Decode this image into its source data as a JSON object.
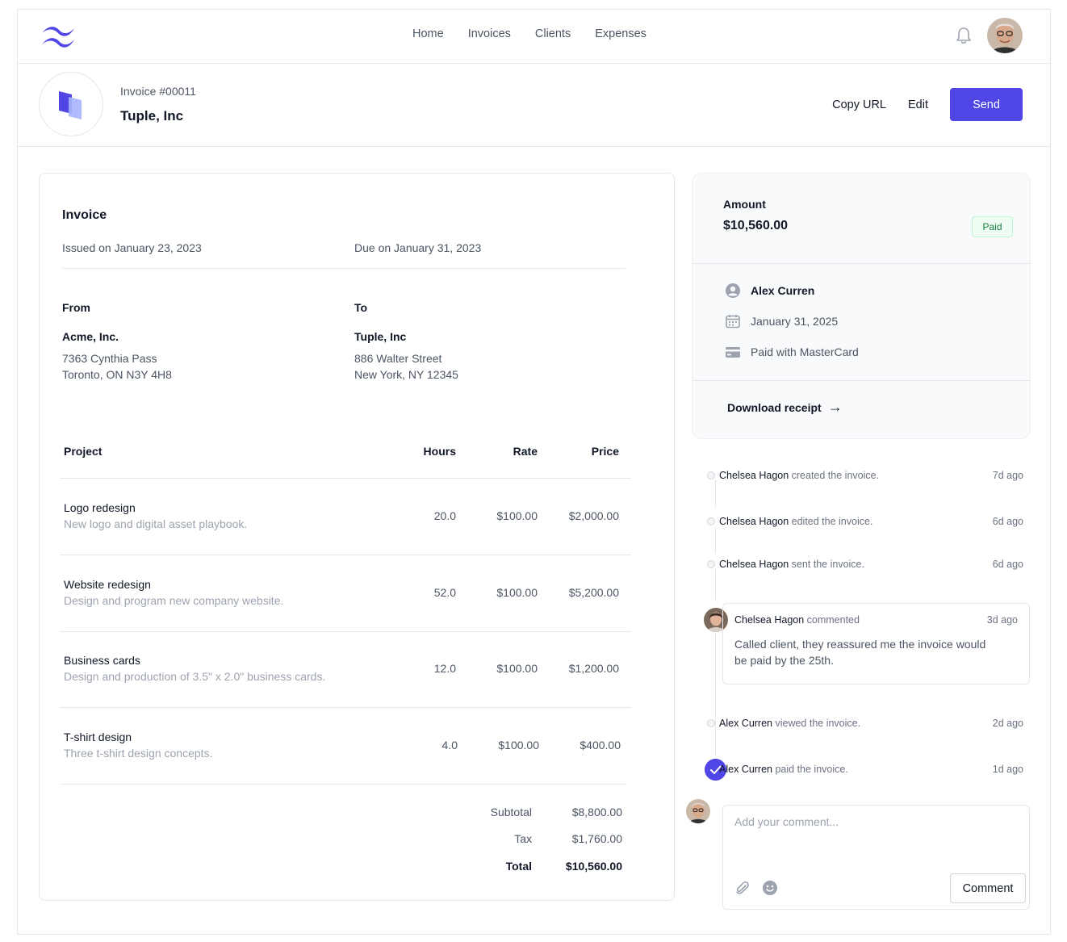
{
  "nav": {
    "links": [
      "Home",
      "Invoices",
      "Clients",
      "Expenses"
    ]
  },
  "header": {
    "invoice_number": "Invoice #00011",
    "client": "Tuple, Inc",
    "copy_url_label": "Copy URL",
    "edit_label": "Edit",
    "send_label": "Send"
  },
  "invoice": {
    "title": "Invoice",
    "issued": "Issued on January 23, 2023",
    "due": "Due on January 31, 2023",
    "from": {
      "label": "From",
      "name": "Acme, Inc.",
      "address_line1": "7363 Cynthia Pass",
      "address_line2": "Toronto, ON N3Y 4H8"
    },
    "to": {
      "label": "To",
      "name": "Tuple, Inc",
      "address_line1": "886 Walter Street",
      "address_line2": "New York, NY 12345"
    },
    "columns": {
      "project": "Project",
      "hours": "Hours",
      "rate": "Rate",
      "price": "Price"
    },
    "items": [
      {
        "title": "Logo redesign",
        "desc": "New logo and digital asset playbook.",
        "hours": "20.0",
        "rate": "$100.00",
        "price": "$2,000.00"
      },
      {
        "title": "Website redesign",
        "desc": "Design and program new company website.",
        "hours": "52.0",
        "rate": "$100.00",
        "price": "$5,200.00"
      },
      {
        "title": "Business cards",
        "desc": "Design and production of 3.5\" x 2.0\" business cards.",
        "hours": "12.0",
        "rate": "$100.00",
        "price": "$1,200.00"
      },
      {
        "title": "T-shirt design",
        "desc": "Three t-shirt design concepts.",
        "hours": "4.0",
        "rate": "$100.00",
        "price": "$400.00"
      }
    ],
    "totals": {
      "subtotal_label": "Subtotal",
      "subtotal": "$8,800.00",
      "tax_label": "Tax",
      "tax": "$1,760.00",
      "total_label": "Total",
      "total": "$10,560.00"
    }
  },
  "summary": {
    "amount_label": "Amount",
    "amount": "$10,560.00",
    "status": "Paid",
    "client_name": "Alex Curren",
    "date": "January 31, 2025",
    "payment_method": "Paid with MasterCard",
    "download_label": "Download receipt"
  },
  "activity": [
    {
      "who": "Chelsea Hagon",
      "what": " created the invoice.",
      "ago": "7d ago"
    },
    {
      "who": "Chelsea Hagon",
      "what": " edited the invoice.",
      "ago": "6d ago"
    },
    {
      "who": "Chelsea Hagon",
      "what": " sent the invoice.",
      "ago": "6d ago"
    },
    {
      "who": "Chelsea Hagon",
      "what": " commented",
      "ago": "3d ago",
      "comment": "Called client, they reassured me the invoice would be paid by the 25th."
    },
    {
      "who": "Alex Curren",
      "what": " viewed the invoice.",
      "ago": "2d ago"
    },
    {
      "who": "Alex Curren",
      "what": " paid the invoice.",
      "ago": "1d ago"
    }
  ],
  "new_comment": {
    "placeholder": "Add your comment...",
    "button_label": "Comment"
  },
  "colors": {
    "accent": "#4f46e5",
    "paid_badge_bg": "#f0fdf4",
    "paid_badge_text": "#15803d"
  }
}
